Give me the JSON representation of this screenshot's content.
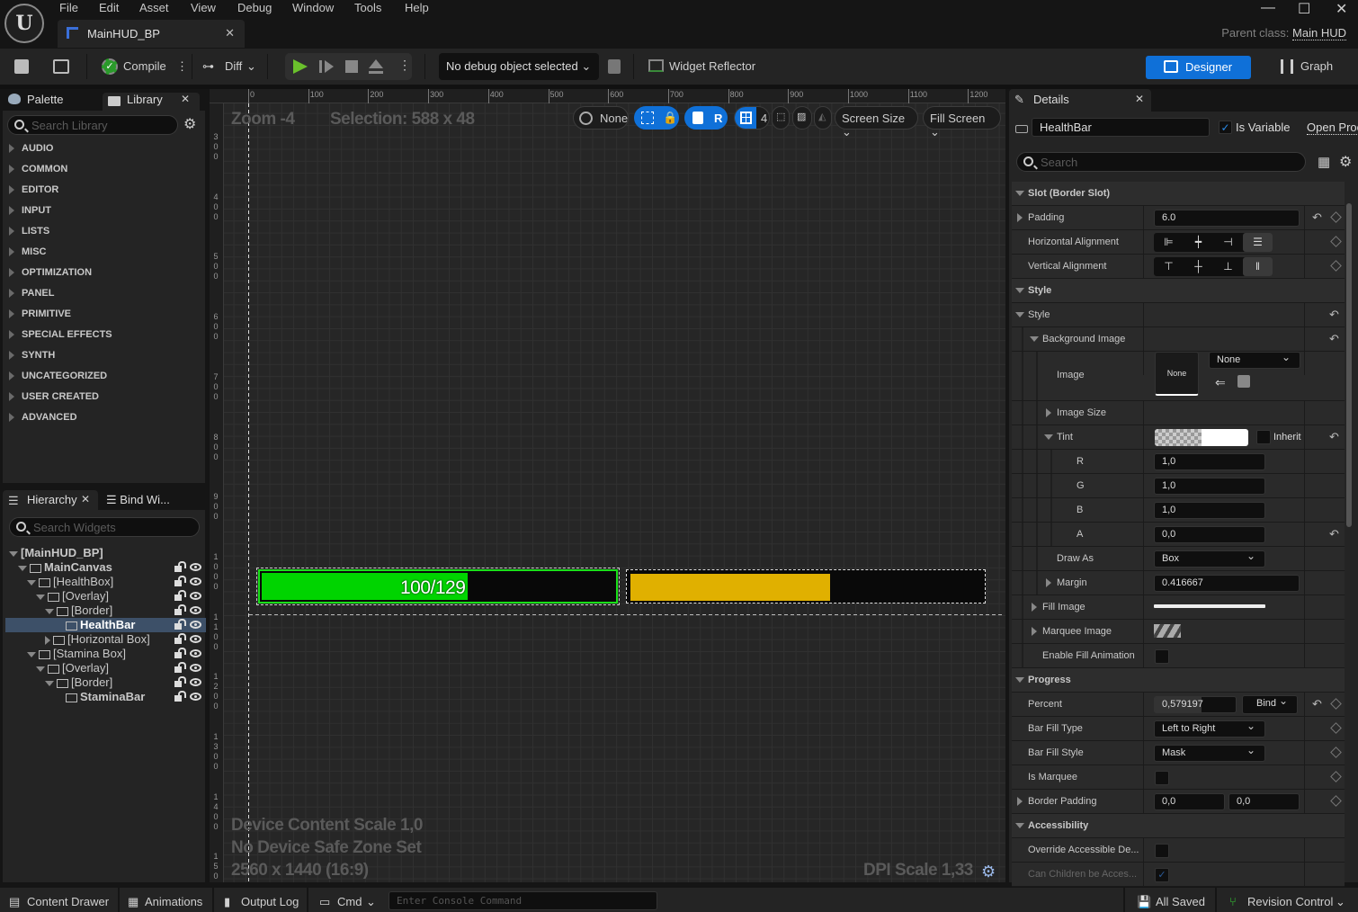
{
  "window": {
    "menu": [
      "File",
      "Edit",
      "Asset",
      "View",
      "Debug",
      "Window",
      "Tools",
      "Help"
    ],
    "tab_title": "MainHUD_BP",
    "parent_class_label": "Parent class:",
    "parent_class_value": "Main HUD"
  },
  "toolbar": {
    "compile": "Compile",
    "diff": "Diff",
    "debug_object": "No debug object selected",
    "widget_reflector": "Widget Reflector",
    "designer": "Designer",
    "graph": "Graph"
  },
  "palette": {
    "tab_palette": "Palette",
    "tab_library": "Library",
    "search_placeholder": "Search Library",
    "categories": [
      "AUDIO",
      "COMMON",
      "EDITOR",
      "INPUT",
      "LISTS",
      "MISC",
      "OPTIMIZATION",
      "PANEL",
      "PRIMITIVE",
      "SPECIAL EFFECTS",
      "SYNTH",
      "UNCATEGORIZED",
      "USER CREATED",
      "ADVANCED"
    ]
  },
  "hierarchy": {
    "tab_hierarchy": "Hierarchy",
    "tab_bind": "Bind Wi...",
    "search_placeholder": "Search Widgets",
    "items": [
      {
        "label": "[MainHUD_BP]",
        "depth": 0,
        "expanded": true,
        "bold": true
      },
      {
        "label": "MainCanvas",
        "depth": 1,
        "expanded": true,
        "bold": true
      },
      {
        "label": "[HealthBox]",
        "depth": 2,
        "expanded": true
      },
      {
        "label": "[Overlay]",
        "depth": 3,
        "expanded": true
      },
      {
        "label": "[Border]",
        "depth": 4,
        "expanded": true
      },
      {
        "label": "HealthBar",
        "depth": 5,
        "bold": true,
        "selected": true
      },
      {
        "label": "[Horizontal Box]",
        "depth": 4,
        "expanded": false
      },
      {
        "label": "[Stamina Box]",
        "depth": 2,
        "expanded": true
      },
      {
        "label": "[Overlay]",
        "depth": 3,
        "expanded": true
      },
      {
        "label": "[Border]",
        "depth": 4,
        "expanded": true
      },
      {
        "label": "StaminaBar",
        "depth": 5,
        "bold": true
      }
    ]
  },
  "canvas": {
    "zoom": "Zoom -4",
    "selection": "Selection: 588 x 48",
    "ruler_h": [
      "0",
      "100",
      "200",
      "300",
      "400",
      "500",
      "600",
      "700",
      "800",
      "900",
      "1000",
      "1100",
      "1200"
    ],
    "ruler_v": [
      "300",
      "400",
      "500",
      "600",
      "700",
      "800",
      "900",
      "1000",
      "1100",
      "1200",
      "1300",
      "1400",
      "1500"
    ],
    "controls": {
      "world": "None",
      "r": "R",
      "grid": "4",
      "screen_size": "Screen Size",
      "fill_screen": "Fill Screen"
    },
    "health_text": "100/129",
    "health_percent": 0.579197,
    "stamina_percent": 0.57,
    "health_color": "#00d400",
    "stamina_color": "#e0b000",
    "device_content_scale": "Device Content Scale 1,0",
    "safe_zone": "No Device Safe Zone Set",
    "resolution": "2560 x 1440 (16:9)",
    "dpi_scale": "DPI Scale 1,33"
  },
  "details": {
    "tab": "Details",
    "widget_name": "HealthBar",
    "is_variable": "Is Variable",
    "open_prop": "Open Proc",
    "search_placeholder": "Search",
    "slot_header": "Slot (Border Slot)",
    "padding_label": "Padding",
    "padding_value": "6.0",
    "h_align_label": "Horizontal Alignment",
    "v_align_label": "Vertical Alignment",
    "style_header": "Style",
    "style_label": "Style",
    "bg_image_label": "Background Image",
    "image_label": "Image",
    "image_thumb": "None",
    "image_select": "None",
    "image_size_label": "Image Size",
    "tint_label": "Tint",
    "inherit_label": "Inherit",
    "r_label": "R",
    "r_value": "1,0",
    "g_label": "G",
    "g_value": "1,0",
    "b_label": "B",
    "b_value": "1,0",
    "a_label": "A",
    "a_value": "0,0",
    "draw_as_label": "Draw As",
    "draw_as_value": "Box",
    "margin_label": "Margin",
    "margin_value": "0.416667",
    "fill_image_label": "Fill Image",
    "marquee_image_label": "Marquee Image",
    "enable_fill_anim_label": "Enable Fill Animation",
    "progress_header": "Progress",
    "percent_label": "Percent",
    "percent_value": "0,579197",
    "bind_label": "Bind",
    "bar_fill_type_label": "Bar Fill Type",
    "bar_fill_type_value": "Left to Right",
    "bar_fill_style_label": "Bar Fill Style",
    "bar_fill_style_value": "Mask",
    "is_marquee_label": "Is Marquee",
    "border_padding_label": "Border Padding",
    "border_padding_x": "0,0",
    "border_padding_y": "0,0",
    "accessibility_header": "Accessibility",
    "override_accessible_label": "Override Accessible De...",
    "can_children_label": "Can Children be Acces..."
  },
  "bottom": {
    "content_drawer": "Content Drawer",
    "animations": "Animations",
    "output_log": "Output Log",
    "cmd": "Cmd",
    "console_placeholder": "Enter Console Command",
    "all_saved": "All Saved",
    "revision_control": "Revision Control"
  }
}
